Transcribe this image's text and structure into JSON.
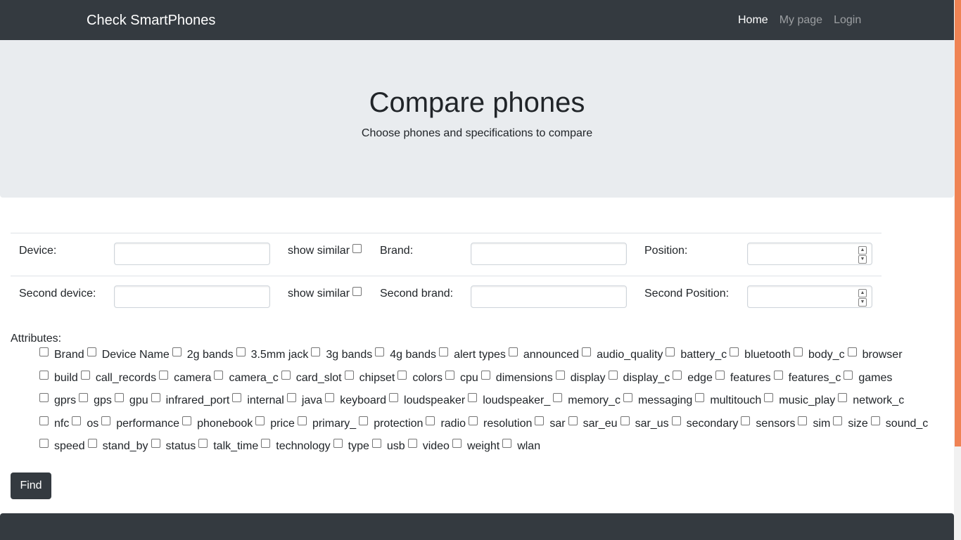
{
  "navbar": {
    "brand": "Check SmartPhones",
    "links": [
      {
        "label": "Home",
        "active": true
      },
      {
        "label": "My page",
        "active": false
      },
      {
        "label": "Login",
        "active": false
      }
    ]
  },
  "hero": {
    "title": "Compare phones",
    "subtitle": "Choose phones and specifications to compare"
  },
  "form": {
    "row1": {
      "device_label": "Device:",
      "device_value": "",
      "show_similar_label": "show similar",
      "brand_label": "Brand:",
      "brand_value": "",
      "position_label": "Position:",
      "position_value": ""
    },
    "row2": {
      "device_label": "Second device:",
      "device_value": "",
      "show_similar_label": "show similar",
      "brand_label": "Second brand:",
      "brand_value": "",
      "position_label": "Second Position:",
      "position_value": ""
    },
    "attributes_label": "Attributes:",
    "attributes": [
      [
        "Brand",
        "Device Name",
        "2g bands",
        "3.5mm jack",
        "3g bands",
        "4g bands",
        "alert types",
        "announced",
        "audio_quality",
        "battery_c",
        "bluetooth",
        "body_c",
        "browser"
      ],
      [
        "build",
        "call_records",
        "camera",
        "camera_c",
        "card_slot",
        "chipset",
        "colors",
        "cpu",
        "dimensions",
        "display",
        "display_c",
        "edge",
        "features",
        "features_c",
        "games"
      ],
      [
        "gprs",
        "gps",
        "gpu",
        "infrared_port",
        "internal",
        "java",
        "keyboard",
        "loudspeaker",
        "loudspeaker_",
        "memory_c",
        "messaging",
        "multitouch",
        "music_play",
        "network_c"
      ],
      [
        "nfc",
        "os",
        "performance",
        "phonebook",
        "price",
        "primary_",
        "protection",
        "radio",
        "resolution",
        "sar",
        "sar_eu",
        "sar_us",
        "secondary",
        "sensors",
        "sim",
        "size",
        "sound_c"
      ],
      [
        "speed",
        "stand_by",
        "status",
        "talk_time",
        "technology",
        "type",
        "usb",
        "video",
        "weight",
        "wlan"
      ]
    ],
    "submit_label": "Find"
  },
  "colors": {
    "navbar_bg": "#343a40",
    "hero_bg": "#e9ecef",
    "scrollbar_accent": "#ef8354"
  }
}
